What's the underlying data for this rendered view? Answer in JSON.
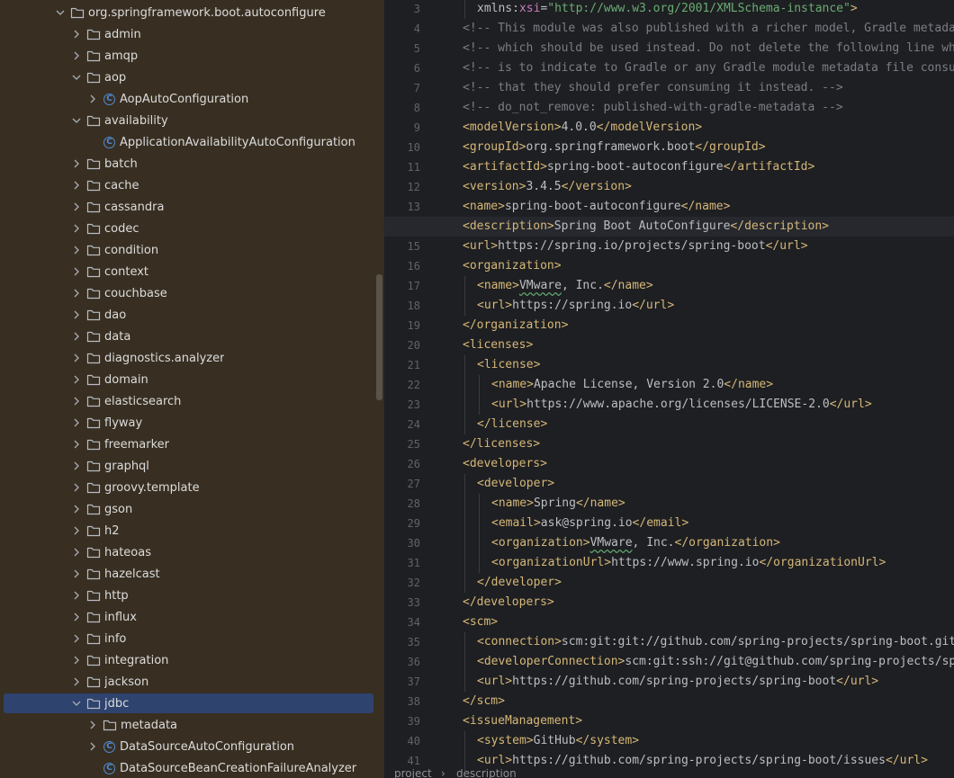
{
  "tree": {
    "items": [
      {
        "label": "org.springframework.boot.autoconfigure",
        "type": "folder",
        "level": 0,
        "expanded": true
      },
      {
        "label": "admin",
        "type": "folder",
        "level": 1,
        "expanded": false
      },
      {
        "label": "amqp",
        "type": "folder",
        "level": 1,
        "expanded": false
      },
      {
        "label": "aop",
        "type": "folder",
        "level": 1,
        "expanded": true
      },
      {
        "label": "AopAutoConfiguration",
        "type": "class",
        "level": 2,
        "expanded": false
      },
      {
        "label": "availability",
        "type": "folder",
        "level": 1,
        "expanded": true
      },
      {
        "label": "ApplicationAvailabilityAutoConfiguration",
        "type": "class",
        "level": 2,
        "leaf": true
      },
      {
        "label": "batch",
        "type": "folder",
        "level": 1,
        "expanded": false
      },
      {
        "label": "cache",
        "type": "folder",
        "level": 1,
        "expanded": false
      },
      {
        "label": "cassandra",
        "type": "folder",
        "level": 1,
        "expanded": false
      },
      {
        "label": "codec",
        "type": "folder",
        "level": 1,
        "expanded": false
      },
      {
        "label": "condition",
        "type": "folder",
        "level": 1,
        "expanded": false
      },
      {
        "label": "context",
        "type": "folder",
        "level": 1,
        "expanded": false
      },
      {
        "label": "couchbase",
        "type": "folder",
        "level": 1,
        "expanded": false
      },
      {
        "label": "dao",
        "type": "folder",
        "level": 1,
        "expanded": false
      },
      {
        "label": "data",
        "type": "folder",
        "level": 1,
        "expanded": false
      },
      {
        "label": "diagnostics.analyzer",
        "type": "folder",
        "level": 1,
        "expanded": false
      },
      {
        "label": "domain",
        "type": "folder",
        "level": 1,
        "expanded": false
      },
      {
        "label": "elasticsearch",
        "type": "folder",
        "level": 1,
        "expanded": false
      },
      {
        "label": "flyway",
        "type": "folder",
        "level": 1,
        "expanded": false
      },
      {
        "label": "freemarker",
        "type": "folder",
        "level": 1,
        "expanded": false
      },
      {
        "label": "graphql",
        "type": "folder",
        "level": 1,
        "expanded": false
      },
      {
        "label": "groovy.template",
        "type": "folder",
        "level": 1,
        "expanded": false
      },
      {
        "label": "gson",
        "type": "folder",
        "level": 1,
        "expanded": false
      },
      {
        "label": "h2",
        "type": "folder",
        "level": 1,
        "expanded": false
      },
      {
        "label": "hateoas",
        "type": "folder",
        "level": 1,
        "expanded": false
      },
      {
        "label": "hazelcast",
        "type": "folder",
        "level": 1,
        "expanded": false
      },
      {
        "label": "http",
        "type": "folder",
        "level": 1,
        "expanded": false
      },
      {
        "label": "influx",
        "type": "folder",
        "level": 1,
        "expanded": false
      },
      {
        "label": "info",
        "type": "folder",
        "level": 1,
        "expanded": false
      },
      {
        "label": "integration",
        "type": "folder",
        "level": 1,
        "expanded": false
      },
      {
        "label": "jackson",
        "type": "folder",
        "level": 1,
        "expanded": false
      },
      {
        "label": "jdbc",
        "type": "folder",
        "level": 1,
        "expanded": true,
        "selected": true
      },
      {
        "label": "metadata",
        "type": "folder",
        "level": 2,
        "expanded": false
      },
      {
        "label": "DataSourceAutoConfiguration",
        "type": "class",
        "level": 2,
        "expanded": false
      },
      {
        "label": "DataSourceBeanCreationFailureAnalyzer",
        "type": "class",
        "level": 2,
        "leaf": true
      }
    ]
  },
  "editor": {
    "current_line": 14,
    "lines": [
      {
        "n": "3",
        "indent": 1,
        "tokens": [
          [
            "attr",
            "xmlns:"
          ],
          [
            "ns",
            "xsi"
          ],
          [
            "attr",
            "="
          ],
          [
            "val",
            "\"http://www.w3.org/2001/XMLSchema-instance\""
          ],
          [
            "tag",
            ">"
          ]
        ]
      },
      {
        "n": "4",
        "indent": 0,
        "tokens": [
          [
            "com",
            "<!-- This module was also published with a richer model, Gradle metadata,  -->"
          ]
        ]
      },
      {
        "n": "5",
        "indent": 0,
        "tokens": [
          [
            "com",
            "<!-- which should be used instead. Do not delete the following line which  -->"
          ]
        ]
      },
      {
        "n": "6",
        "indent": 0,
        "tokens": [
          [
            "com",
            "<!-- is to indicate to Gradle or any Gradle module metadata file consumer  -->"
          ]
        ]
      },
      {
        "n": "7",
        "indent": 0,
        "tokens": [
          [
            "com",
            "<!-- that they should prefer consuming it instead. -->"
          ]
        ]
      },
      {
        "n": "8",
        "indent": 0,
        "tokens": [
          [
            "com",
            "<!-- do_not_remove: published-with-gradle-metadata -->"
          ]
        ]
      },
      {
        "n": "9",
        "indent": 0,
        "tokens": [
          [
            "tag",
            "<modelVersion>"
          ],
          [
            "txt",
            "4.0.0"
          ],
          [
            "tag",
            "</modelVersion>"
          ]
        ]
      },
      {
        "n": "10",
        "indent": 0,
        "tokens": [
          [
            "tag",
            "<groupId>"
          ],
          [
            "txt",
            "org.springframework.boot"
          ],
          [
            "tag",
            "</groupId>"
          ]
        ]
      },
      {
        "n": "11",
        "indent": 0,
        "tokens": [
          [
            "tag",
            "<artifactId>"
          ],
          [
            "txt",
            "spring-boot-autoconfigure"
          ],
          [
            "tag",
            "</artifactId>"
          ]
        ]
      },
      {
        "n": "12",
        "indent": 0,
        "tokens": [
          [
            "tag",
            "<version>"
          ],
          [
            "txt",
            "3.4.5"
          ],
          [
            "tag",
            "</version>"
          ]
        ]
      },
      {
        "n": "13",
        "indent": 0,
        "tokens": [
          [
            "tag",
            "<name>"
          ],
          [
            "txt",
            "spring-boot-autoconfigure"
          ],
          [
            "tag",
            "</name>"
          ]
        ]
      },
      {
        "n": "14",
        "indent": 0,
        "tokens": [
          [
            "tag",
            "<description>"
          ],
          [
            "txt",
            "Spring Boot AutoConfigure"
          ],
          [
            "tag",
            "</description>"
          ]
        ]
      },
      {
        "n": "15",
        "indent": 0,
        "tokens": [
          [
            "tag",
            "<url>"
          ],
          [
            "txt",
            "https://spring.io/projects/spring-boot"
          ],
          [
            "tag",
            "</url>"
          ]
        ]
      },
      {
        "n": "16",
        "indent": 0,
        "tokens": [
          [
            "tag",
            "<organization>"
          ]
        ]
      },
      {
        "n": "17",
        "indent": 1,
        "tokens": [
          [
            "tag",
            "<name>"
          ],
          [
            "typo",
            "VMware"
          ],
          [
            "txt",
            ", Inc."
          ],
          [
            "tag",
            "</name>"
          ]
        ]
      },
      {
        "n": "18",
        "indent": 1,
        "tokens": [
          [
            "tag",
            "<url>"
          ],
          [
            "txt",
            "https://spring.io"
          ],
          [
            "tag",
            "</url>"
          ]
        ]
      },
      {
        "n": "19",
        "indent": 0,
        "tokens": [
          [
            "tag",
            "</organization>"
          ]
        ]
      },
      {
        "n": "20",
        "indent": 0,
        "tokens": [
          [
            "tag",
            "<licenses>"
          ]
        ]
      },
      {
        "n": "21",
        "indent": 1,
        "tokens": [
          [
            "tag",
            "<license>"
          ]
        ]
      },
      {
        "n": "22",
        "indent": 2,
        "tokens": [
          [
            "tag",
            "<name>"
          ],
          [
            "txt",
            "Apache License, Version 2.0"
          ],
          [
            "tag",
            "</name>"
          ]
        ]
      },
      {
        "n": "23",
        "indent": 2,
        "tokens": [
          [
            "tag",
            "<url>"
          ],
          [
            "txt",
            "https://www.apache.org/licenses/LICENSE-2.0"
          ],
          [
            "tag",
            "</url>"
          ]
        ]
      },
      {
        "n": "24",
        "indent": 1,
        "tokens": [
          [
            "tag",
            "</license>"
          ]
        ]
      },
      {
        "n": "25",
        "indent": 0,
        "tokens": [
          [
            "tag",
            "</licenses>"
          ]
        ]
      },
      {
        "n": "26",
        "indent": 0,
        "tokens": [
          [
            "tag",
            "<developers>"
          ]
        ]
      },
      {
        "n": "27",
        "indent": 1,
        "tokens": [
          [
            "tag",
            "<developer>"
          ]
        ]
      },
      {
        "n": "28",
        "indent": 2,
        "tokens": [
          [
            "tag",
            "<name>"
          ],
          [
            "txt",
            "Spring"
          ],
          [
            "tag",
            "</name>"
          ]
        ]
      },
      {
        "n": "29",
        "indent": 2,
        "tokens": [
          [
            "tag",
            "<email>"
          ],
          [
            "txt",
            "ask@spring.io"
          ],
          [
            "tag",
            "</email>"
          ]
        ]
      },
      {
        "n": "30",
        "indent": 2,
        "tokens": [
          [
            "tag",
            "<organization>"
          ],
          [
            "typo",
            "VMware"
          ],
          [
            "txt",
            ", Inc."
          ],
          [
            "tag",
            "</organization>"
          ]
        ]
      },
      {
        "n": "31",
        "indent": 2,
        "tokens": [
          [
            "tag",
            "<organizationUrl>"
          ],
          [
            "txt",
            "https://www.spring.io"
          ],
          [
            "tag",
            "</organizationUrl>"
          ]
        ]
      },
      {
        "n": "32",
        "indent": 1,
        "tokens": [
          [
            "tag",
            "</developer>"
          ]
        ]
      },
      {
        "n": "33",
        "indent": 0,
        "tokens": [
          [
            "tag",
            "</developers>"
          ]
        ]
      },
      {
        "n": "34",
        "indent": 0,
        "tokens": [
          [
            "tag",
            "<scm>"
          ]
        ]
      },
      {
        "n": "35",
        "indent": 1,
        "tokens": [
          [
            "tag",
            "<connection>"
          ],
          [
            "txt",
            "scm:git:git://github.com/spring-projects/spring-boot.git"
          ],
          [
            "tag",
            "</connection>"
          ]
        ]
      },
      {
        "n": "36",
        "indent": 1,
        "tokens": [
          [
            "tag",
            "<developerConnection>"
          ],
          [
            "txt",
            "scm:git:ssh://git@github.com/spring-projects/spring-boot.git"
          ],
          [
            "tag",
            "</developerConnection>"
          ]
        ]
      },
      {
        "n": "37",
        "indent": 1,
        "tokens": [
          [
            "tag",
            "<url>"
          ],
          [
            "txt",
            "https://github.com/spring-projects/spring-boot"
          ],
          [
            "tag",
            "</url>"
          ]
        ]
      },
      {
        "n": "38",
        "indent": 0,
        "tokens": [
          [
            "tag",
            "</scm>"
          ]
        ]
      },
      {
        "n": "39",
        "indent": 0,
        "tokens": [
          [
            "tag",
            "<issueManagement>"
          ]
        ]
      },
      {
        "n": "40",
        "indent": 1,
        "tokens": [
          [
            "tag",
            "<system>"
          ],
          [
            "txt",
            "GitHub"
          ],
          [
            "tag",
            "</system>"
          ]
        ]
      },
      {
        "n": "41",
        "indent": 1,
        "tokens": [
          [
            "tag",
            "<url>"
          ],
          [
            "txt",
            "https://github.com/spring-projects/spring-boot/issues"
          ],
          [
            "tag",
            "</url>"
          ]
        ]
      }
    ]
  },
  "breadcrumb": {
    "items": [
      "project",
      "description"
    ]
  },
  "colors": {
    "tag": "#d5b778",
    "comment": "#7a7e85",
    "string": "#6aab73",
    "namespace": "#c77dbb",
    "selection": "#2e436e",
    "tree_bg": "#382f22",
    "editor_bg": "#1e1f22"
  }
}
